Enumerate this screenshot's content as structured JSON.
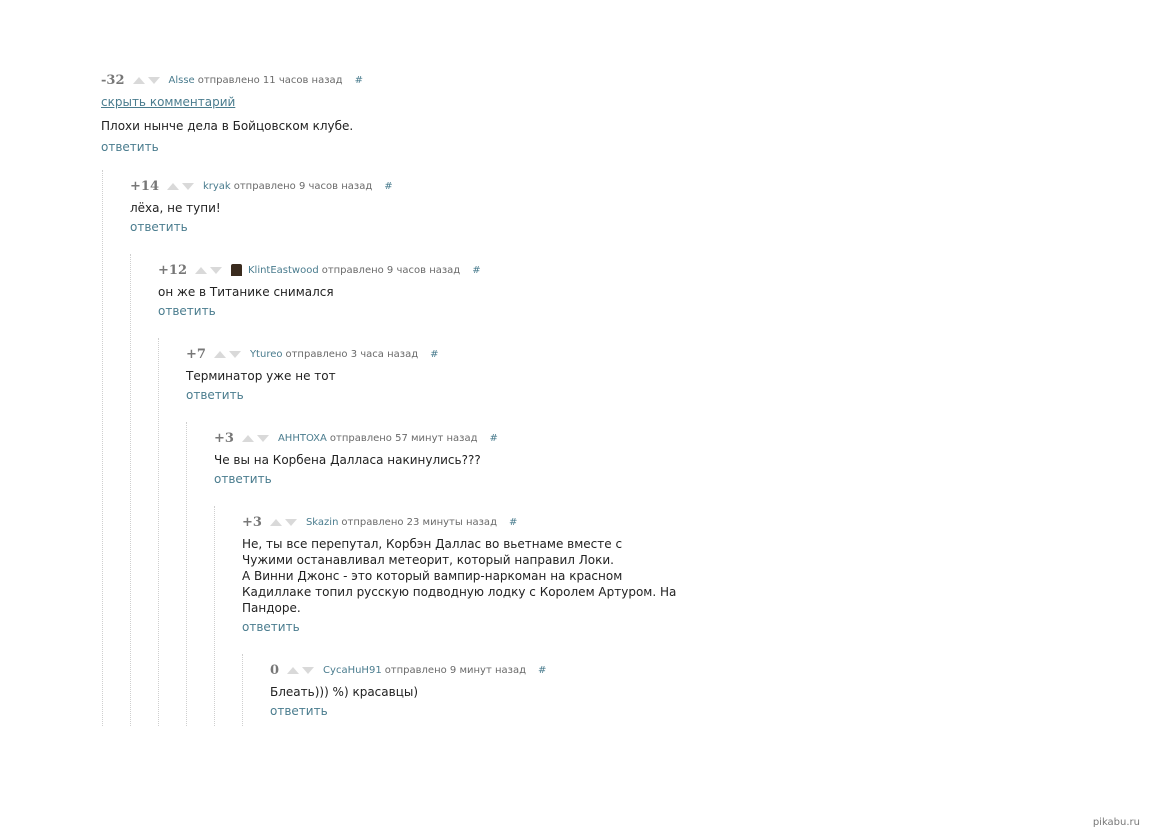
{
  "comments": [
    {
      "rating": "-32",
      "author": "Alsse",
      "time": "отправлено 11 часов назад",
      "hash": "#",
      "text": "Плохи нынче дела в Бойцовском клубе.",
      "reply": "ответить",
      "avatar": false
    },
    {
      "rating": "+14",
      "author": "kryak",
      "time": "отправлено 9 часов назад",
      "hash": "#",
      "text": "лёха, не тупи!",
      "reply": "ответить",
      "avatar": false
    },
    {
      "rating": "+12",
      "author": "KlintEastwood",
      "time": "отправлено 9 часов назад",
      "hash": "#",
      "text": "он же в Титанике снимался",
      "reply": "ответить",
      "avatar": true
    },
    {
      "rating": "+7",
      "author": "Ytureo",
      "time": "отправлено 3 часа назад",
      "hash": "#",
      "text": "Терминатор уже не тот",
      "reply": "ответить",
      "avatar": false
    },
    {
      "rating": "+3",
      "author": "AHHTOXA",
      "time": "отправлено 57 минут назад",
      "hash": "#",
      "text": "Че вы на Корбена Далласа накинулись???",
      "reply": "ответить",
      "avatar": false
    },
    {
      "rating": "+3",
      "author": "Skazin",
      "time": "отправлено 23 минуты назад",
      "hash": "#",
      "text": "Не, ты все перепутал, Корбэн Даллас во вьетнаме вместе с\nЧужими останавливал метеорит, который направил Локи.\nА Винни Джонс - это который вампир-наркоман на красном\nКадиллаке топил русскую подводную лодку с Королем Артуром. На\nПандоре.",
      "reply": "ответить",
      "avatar": false
    },
    {
      "rating": "0",
      "author": "CycaHuH91",
      "time": "отправлено 9 минут назад",
      "hash": "#",
      "text": "Блеать))) %) красавцы)",
      "reply": "ответить",
      "avatar": false
    }
  ],
  "hide_comment": "скрыть комментарий",
  "watermark": "pikabu.ru"
}
